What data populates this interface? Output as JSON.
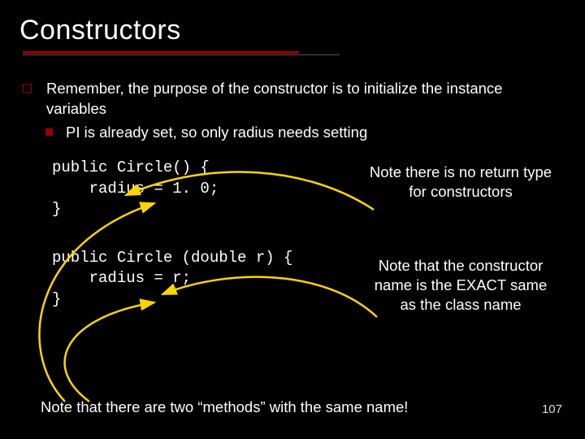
{
  "title": "Constructors",
  "bullet1": "Remember, the purpose of the constructor is to initialize the instance variables",
  "bullet2": "PI is already set, so only radius needs setting",
  "code1": "public Circle() {\n    radius = 1. 0;\n}",
  "callout1": "Note there is no return type for constructors",
  "code2": "public Circle (double r) {\n    radius = r;\n}",
  "callout2": "Note that the constructor name is the EXACT same as the class name",
  "footer": "Note that there are two “methods” with the same name!",
  "pagenum": "107",
  "arrow_color": "#ffd500"
}
